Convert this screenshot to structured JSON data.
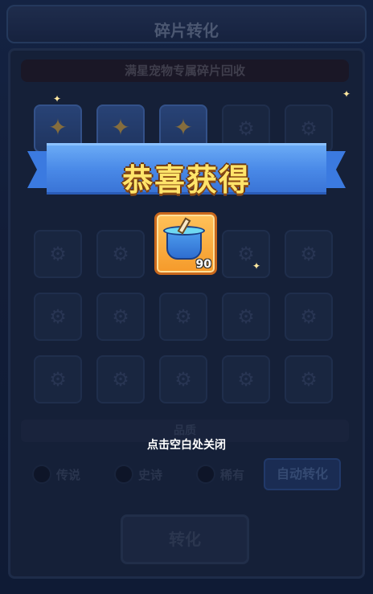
{
  "header": {
    "title": "碎片转化"
  },
  "subtitle": "满星宠物专属碎片回收",
  "quality": {
    "label": "品质",
    "options": [
      "传说",
      "史诗",
      "稀有"
    ]
  },
  "buttons": {
    "auto_convert": "自动转化",
    "convert": "转化"
  },
  "reward_popup": {
    "title": "恭喜获得",
    "item_icon": "paint-bucket-icon",
    "item_count": "90",
    "close_hint": "点击空白处关闭"
  },
  "colors": {
    "ribbon": "#4a8ae8",
    "ribbon_text": "#ffe46a",
    "reward_card": "#f59a2a",
    "background": "#172546"
  }
}
